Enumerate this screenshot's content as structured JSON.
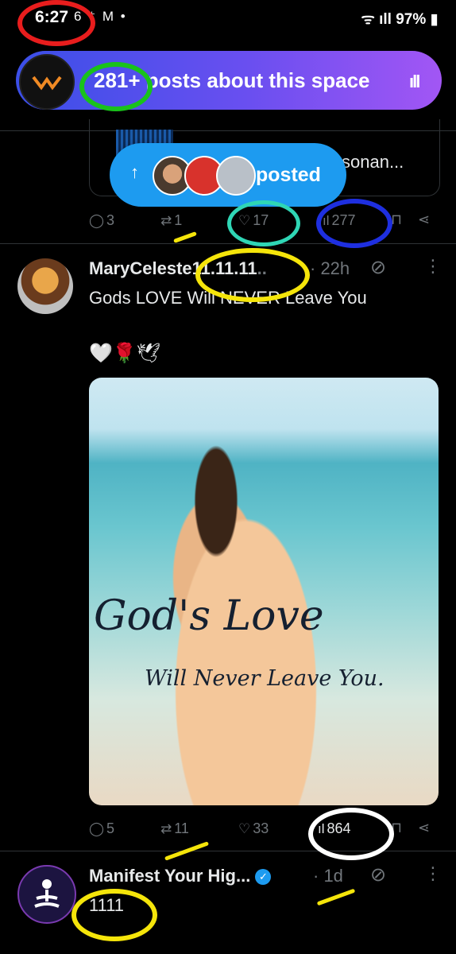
{
  "status_bar": {
    "time": "6:27",
    "left_icons": "6 ⁺ M •",
    "battery": "97%",
    "right_icons": "ᯤ ıll"
  },
  "space_banner": {
    "text": "281+ posts about this space",
    "wave_icon": "audio-wave-icon"
  },
  "posted_pill": {
    "arrow": "↑",
    "label": "posted"
  },
  "post1": {
    "quote_text": "sonan...",
    "replies": "3",
    "reposts": "1",
    "likes": "17",
    "views": "277"
  },
  "post2": {
    "author": "MaryCeleste11.11.11",
    "author_suffix": "..",
    "time": "· 22h",
    "text": "Gods LOVE  Will NEVER Leave You",
    "emojis": "🤍🌹🕊",
    "image_title": "God's Love",
    "image_subtitle": "Will Never Leave You.",
    "replies": "5",
    "reposts": "11",
    "likes": "33",
    "views": "864"
  },
  "post3": {
    "author": "Manifest Your Hig...",
    "time": "· 1d",
    "text": "1111"
  },
  "colors": {
    "accent": "#1d9bf0",
    "muted": "#71767b",
    "annotation_red": "#e81d1d",
    "annotation_green": "#19c21b",
    "annotation_yellow": "#f5e50a",
    "annotation_blue": "#1e2fe0",
    "annotation_teal": "#2fd6b5",
    "annotation_white": "#ffffff"
  }
}
